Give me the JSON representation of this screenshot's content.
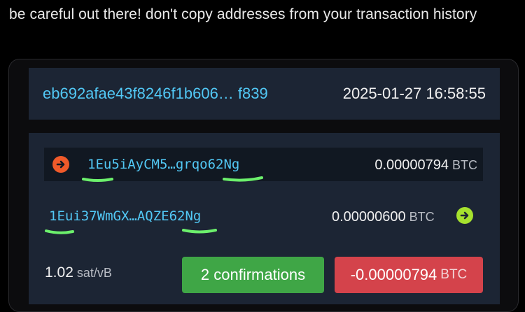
{
  "caption": "be careful out there! don't copy addresses from your transaction history",
  "transaction": {
    "txid": "eb692afae43f8246f1b606… f839",
    "timestamp": "2025-01-27 16:58:55"
  },
  "inputs": [
    {
      "address": "1Eu5iAyCM5…grqo62Ng",
      "amount": "0.00000794",
      "unit": "BTC"
    }
  ],
  "outputs": [
    {
      "address": "1Eui37WmGX…AQZE62Ng",
      "amount": "0.00000600",
      "unit": "BTC"
    }
  ],
  "footer": {
    "fee_rate": "1.02",
    "fee_unit": "sat/vB",
    "confirmations": "2 confirmations",
    "net_amount": "-0.00000794",
    "net_unit": "BTC"
  },
  "colors": {
    "link": "#52c8f5",
    "input_marker": "#f05a2a",
    "output_marker": "#a6e22e",
    "confirmations": "#3fa646",
    "negative": "#d4434b",
    "highlight_marks": "#6cf06c"
  },
  "icons": {
    "input_marker": "arrow-right-circle-icon",
    "output_marker": "arrow-right-circle-icon"
  }
}
